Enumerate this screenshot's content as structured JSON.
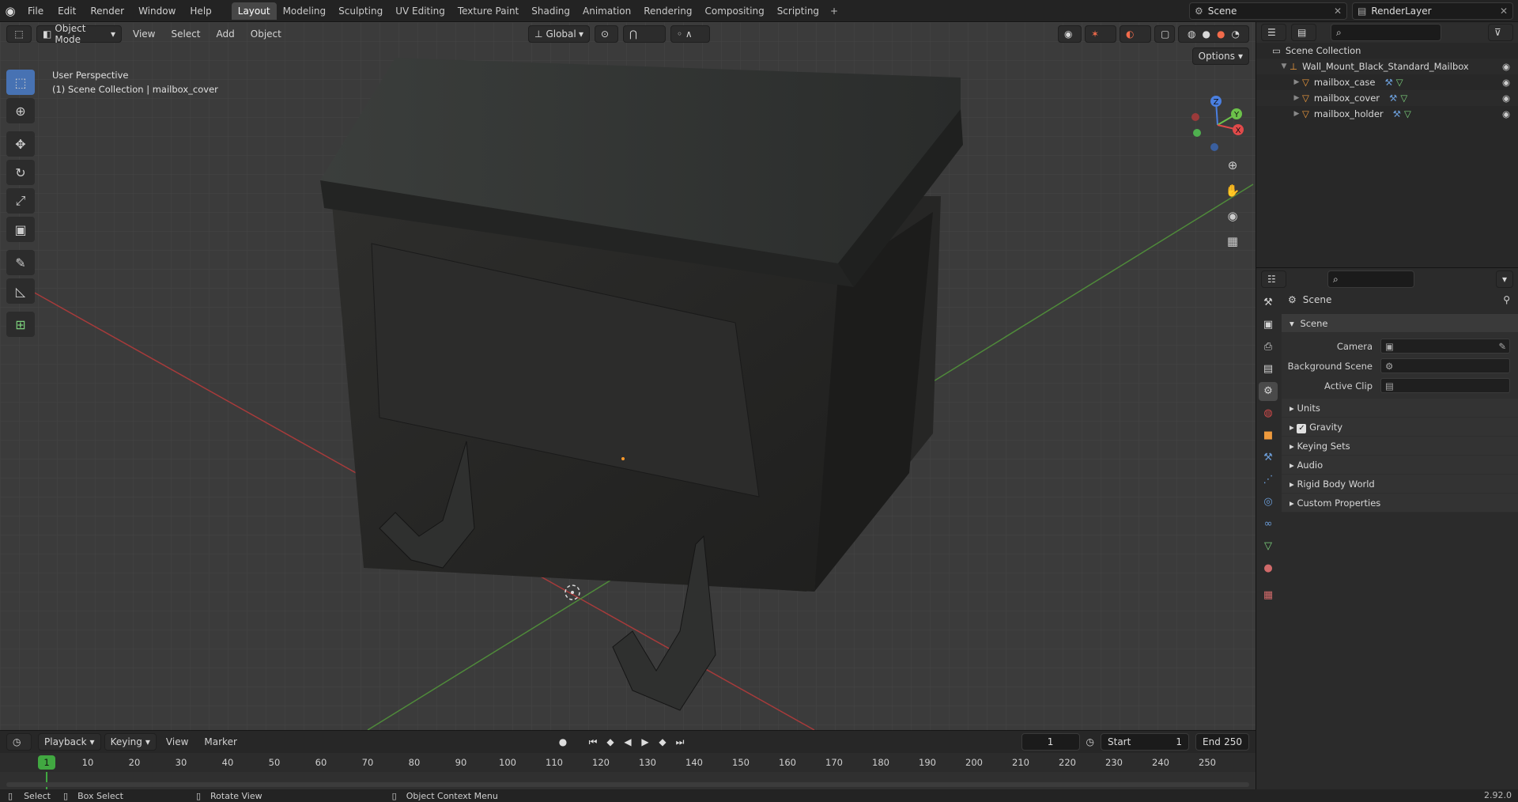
{
  "topbar": {
    "menu": [
      "File",
      "Edit",
      "Render",
      "Window",
      "Help"
    ],
    "tabs": [
      "Layout",
      "Modeling",
      "Sculpting",
      "UV Editing",
      "Texture Paint",
      "Shading",
      "Animation",
      "Rendering",
      "Compositing",
      "Scripting"
    ],
    "active_tab": "Layout",
    "add": "+",
    "scene": "Scene",
    "view_layer": "RenderLayer"
  },
  "viewport": {
    "mode": "Object Mode",
    "menu": [
      "View",
      "Select",
      "Add",
      "Object"
    ],
    "transform_orientation": "Global",
    "options": "Options",
    "info_line1": "User Perspective",
    "info_line2": "(1) Scene Collection | mailbox_cover",
    "gizmo": {
      "x": "X",
      "y": "Y",
      "z": "Z"
    }
  },
  "outliner": {
    "root": "Scene Collection",
    "collection": "Wall_Mount_Black_Standard_Mailbox",
    "objects": [
      {
        "name": "mailbox_case"
      },
      {
        "name": "mailbox_cover"
      },
      {
        "name": "mailbox_holder"
      }
    ]
  },
  "properties": {
    "header": "Scene",
    "section": "Scene",
    "rows": [
      {
        "label": "Camera"
      },
      {
        "label": "Background Scene"
      },
      {
        "label": "Active Clip"
      }
    ],
    "panels": [
      "Units",
      "Gravity",
      "Keying Sets",
      "Audio",
      "Rigid Body World",
      "Custom Properties"
    ]
  },
  "timeline": {
    "menu": [
      "Playback",
      "Keying",
      "View",
      "Marker"
    ],
    "current_frame": "1",
    "ticks": [
      "1",
      "10",
      "20",
      "30",
      "40",
      "50",
      "60",
      "70",
      "80",
      "90",
      "100",
      "110",
      "120",
      "130",
      "140",
      "150",
      "160",
      "170",
      "180",
      "190",
      "200",
      "210",
      "220",
      "230",
      "240",
      "250"
    ],
    "frame_field": "1",
    "start_label": "Start",
    "start": "1",
    "end_label": "End",
    "end": "250"
  },
  "status": {
    "select": "Select",
    "box_select": "Box Select",
    "rotate_view": "Rotate View",
    "context_menu": "Object Context Menu",
    "version": "2.92.0"
  }
}
